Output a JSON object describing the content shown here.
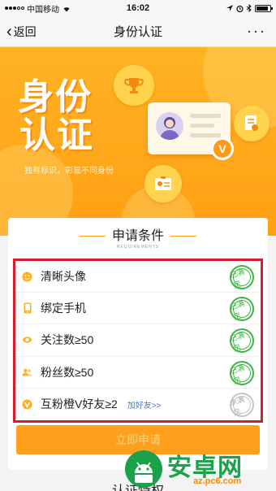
{
  "status_bar": {
    "carrier": "中国移动",
    "time": "16:02"
  },
  "nav": {
    "back_label": "返回",
    "title": "身份认证",
    "more_label": "···"
  },
  "banner": {
    "title_line1": "身份",
    "title_line2": "认证",
    "subtitle": "独有标识，彰显不同身份",
    "badge_letter": "V"
  },
  "requirements": {
    "title": "申请条件",
    "title_en": "REQUIREMENTS",
    "items": [
      {
        "icon": "smile-icon",
        "label": "清晰头像",
        "status": "已满足",
        "link": ""
      },
      {
        "icon": "phone-icon",
        "label": "绑定手机",
        "status": "已满足",
        "link": ""
      },
      {
        "icon": "eye-icon",
        "label": "关注数≥50",
        "status": "已满足",
        "link": ""
      },
      {
        "icon": "users-icon",
        "label": "粉丝数≥50",
        "status": "已满足",
        "link": ""
      },
      {
        "icon": "v-badge-icon",
        "label": "互粉橙V好友≥2",
        "status": "未满足",
        "link": "加好友>>"
      }
    ],
    "apply_label": "立即申请"
  },
  "bottom_section": {
    "title": "认证特权"
  },
  "watermark": {
    "brand": "安卓网",
    "url": "az.pc6.com"
  },
  "colors": {
    "accent": "#ffa01c",
    "highlight_border": "#d3202d",
    "met_stamp": "#3db446"
  }
}
